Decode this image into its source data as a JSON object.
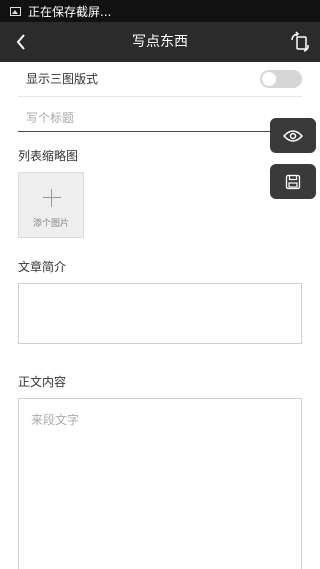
{
  "status_bar": {
    "text": "正在保存截屏..."
  },
  "header": {
    "title": "写点东西"
  },
  "form": {
    "template_toggle_label": "显示三图版式",
    "title_placeholder": "写个标题",
    "thumbnail_label": "列表缩略图",
    "add_image_label": "添个图片",
    "summary_label": "文章简介",
    "body_label": "正文内容",
    "body_placeholder": "来段文字"
  },
  "icons": {
    "back": "chevron-left-icon",
    "switch": "switch-orientation-icon",
    "preview": "eye-icon",
    "save": "save-icon",
    "status": "image-icon"
  }
}
